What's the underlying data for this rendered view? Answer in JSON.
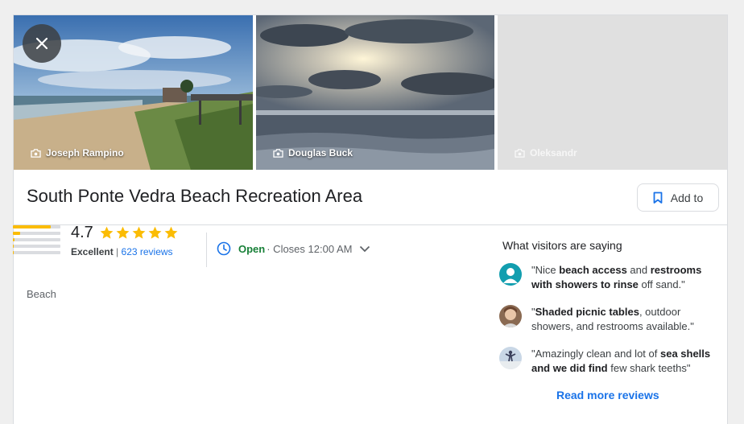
{
  "photos": [
    {
      "credit": "Joseph Rampino"
    },
    {
      "credit": "Douglas Buck"
    },
    {
      "credit": "Oleksandr"
    }
  ],
  "place": {
    "title": "South Ponte Vedra Beach Recreation Area",
    "add_to_label": "Add to",
    "category": "Beach"
  },
  "rating": {
    "score": "4.7",
    "stars": 5,
    "word": "Excellent",
    "separator": "|",
    "reviews_label": "623 reviews",
    "distribution": [
      0.8,
      0.15,
      0.03,
      0.02,
      0.02
    ]
  },
  "hours": {
    "status": "Open",
    "detail": "· Closes 12:00 AM"
  },
  "visitors": {
    "heading": "What visitors are saying",
    "reviews": [
      {
        "parts": [
          {
            "t": "\"Nice ",
            "b": false
          },
          {
            "t": "beach access",
            "b": true
          },
          {
            "t": " and ",
            "b": false
          },
          {
            "t": "restrooms with showers to rinse",
            "b": true
          },
          {
            "t": " off sand.\"",
            "b": false
          }
        ]
      },
      {
        "parts": [
          {
            "t": "\"",
            "b": false
          },
          {
            "t": "Shaded picnic tables",
            "b": true
          },
          {
            "t": ", outdoor showers, and restrooms available.\"",
            "b": false
          }
        ]
      },
      {
        "parts": [
          {
            "t": "\"Amazingly clean and lot of ",
            "b": false
          },
          {
            "t": "sea shells and we did find",
            "b": true
          },
          {
            "t": " few shark teeths\"",
            "b": false
          }
        ]
      }
    ],
    "read_more": "Read more reviews"
  },
  "colors": {
    "accent_blue": "#1a73e8",
    "open_green": "#188038",
    "star_yellow": "#fbbc04"
  },
  "icons": [
    "close-icon",
    "camera-icon",
    "bookmark-icon",
    "star-icon",
    "clock-icon",
    "chevron-down-icon"
  ]
}
